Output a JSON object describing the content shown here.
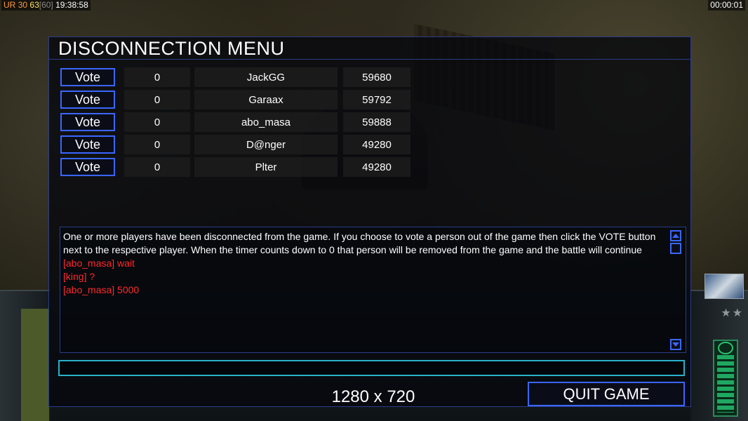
{
  "overlay": {
    "ur_label": "UR",
    "fps_a": "30",
    "fps_b": "63",
    "fps_c": "[60]",
    "clock": "19:38:58",
    "game_timer": "00:00:01"
  },
  "dialog": {
    "title": "DISCONNECTION MENU",
    "players": [
      {
        "vote_label": "Vote",
        "votes": "0",
        "name": "JackGG",
        "value": "59680"
      },
      {
        "vote_label": "Vote",
        "votes": "0",
        "name": "Garaax",
        "value": "59792"
      },
      {
        "vote_label": "Vote",
        "votes": "0",
        "name": "abo_masa",
        "value": "59888"
      },
      {
        "vote_label": "Vote",
        "votes": "0",
        "name": "D@nger",
        "value": "49280"
      },
      {
        "vote_label": "Vote",
        "votes": "0",
        "name": "Plter",
        "value": "49280"
      }
    ],
    "chat": {
      "system_message": "One or more players have been disconnected from the game. If you choose to vote a person out of the game then click the VOTE button next to the respective player. When the timer counts down to 0 that person will be removed from the game and the battle will continue",
      "messages": [
        "[abo_masa] wait",
        "[king] ?",
        "[abo_masa] 5000"
      ]
    },
    "chat_input": {
      "value": ""
    },
    "resolution": "1280 x 720",
    "quit_label": "QUIT GAME"
  },
  "colors": {
    "accent_blue": "#3a66ff",
    "input_cyan": "#2ab0c8",
    "player_chat_red": "#ff2a2a"
  }
}
